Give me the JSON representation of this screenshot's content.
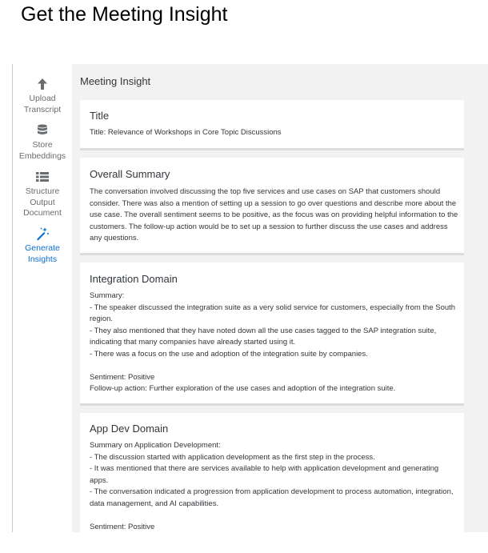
{
  "page_title": "Get the Meeting Insight",
  "sidebar": {
    "items": [
      {
        "line1": "Upload",
        "line2": "Transcript",
        "line3": "",
        "icon": "arrow-up-icon"
      },
      {
        "line1": "Store",
        "line2": "Embeddings",
        "line3": "",
        "icon": "database-icon"
      },
      {
        "line1": "Structure",
        "line2": "Output",
        "line3": "Document",
        "icon": "list-icon"
      },
      {
        "line1": "Generate",
        "line2": "Insights",
        "line3": "",
        "icon": "magic-wand-icon",
        "active": true
      }
    ],
    "active_color": "#0a6ed1"
  },
  "main": {
    "header": "Meeting Insight",
    "cards": {
      "title": {
        "heading": "Title",
        "text": "Title: Relevance of Workshops in Core Topic Discussions"
      },
      "summary": {
        "heading": "Overall Summary",
        "text": "The conversation involved discussing the top five services and use cases on SAP that customers should consider. There was also a mention of setting up a session to go over questions and describe more about the use case. The overall sentiment seems to be positive, as the focus was on providing helpful information to the customers. The follow-up action would be to set up a session to further discuss the use cases and address any questions."
      },
      "integration": {
        "heading": "Integration Domain",
        "summary_label": "Summary:",
        "points": [
          "- The speaker discussed the integration suite as a very solid service for customers, especially from the South region.",
          "- They also mentioned that they have noted down all the use cases tagged to the SAP integration suite, indicating that many companies have already started using it.",
          "- There was a focus on the use and adoption of the integration suite by companies."
        ],
        "sentiment": "Sentiment: Positive",
        "followup": "Follow-up action: Further exploration of the use cases and adoption of the integration suite."
      },
      "appdev": {
        "heading": "App Dev Domain",
        "summary_label": "Summary on Application Development:",
        "points": [
          "- The discussion started with application development as the first step in the process.",
          "- It was mentioned that there are services available to help with application development and generating apps.",
          "- The conversation indicated a progression from application development to process automation, integration, data management, and AI capabilities."
        ],
        "sentiment": "Sentiment: Positive"
      }
    }
  }
}
